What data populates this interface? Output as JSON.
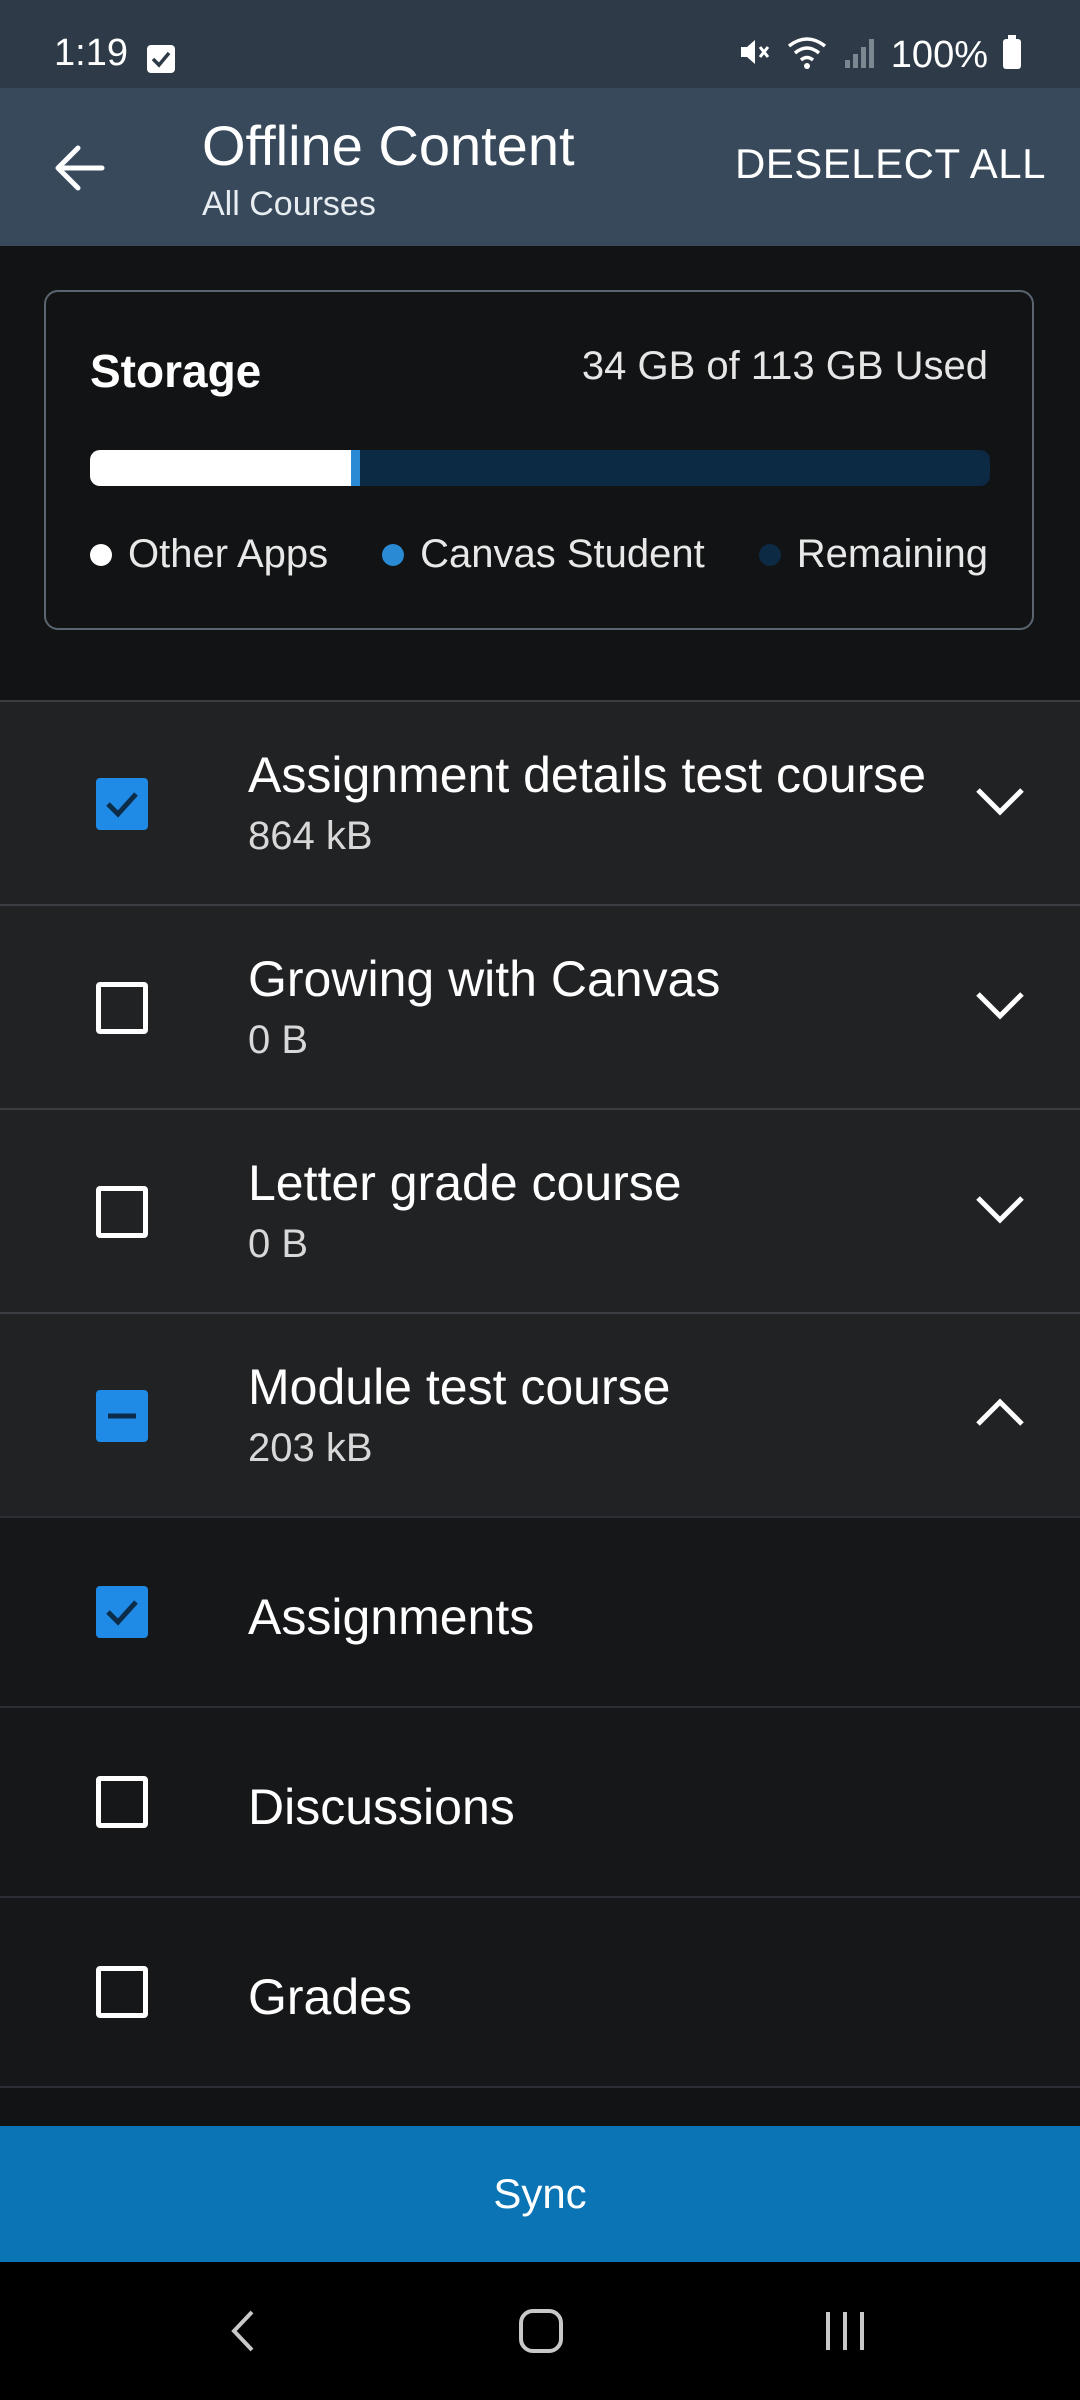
{
  "status_bar": {
    "time": "1:19",
    "battery": "100%"
  },
  "app_bar": {
    "title": "Offline Content",
    "subtitle": "All Courses",
    "deselect_all": "DESELECT ALL"
  },
  "storage": {
    "title": "Storage",
    "used_text": "34 GB of 113 GB Used",
    "other_apps_fraction": 0.29,
    "canvas_student_fraction": 0.01,
    "legend": [
      {
        "label": "Other Apps",
        "color": "#ffffff"
      },
      {
        "label": "Canvas Student",
        "color": "#2a8ad4"
      },
      {
        "label": "Remaining",
        "color": "#0c2a44"
      }
    ]
  },
  "courses": [
    {
      "name": "Assignment details test course",
      "size": "864 kB",
      "state": "checked",
      "expanded": false
    },
    {
      "name": "Growing with Canvas",
      "size": "0 B",
      "state": "unchecked",
      "expanded": false
    },
    {
      "name": "Letter grade course",
      "size": "0 B",
      "state": "unchecked",
      "expanded": false
    },
    {
      "name": "Module test course",
      "size": "203 kB",
      "state": "partial",
      "expanded": true
    }
  ],
  "module_items": [
    {
      "name": "Assignments",
      "state": "checked"
    },
    {
      "name": "Discussions",
      "state": "unchecked"
    },
    {
      "name": "Grades",
      "state": "unchecked"
    }
  ],
  "sync_button": "Sync",
  "colors": {
    "accent": "#1f8be6",
    "sync_bg": "#0a74b5",
    "app_bar": "#37495a"
  }
}
